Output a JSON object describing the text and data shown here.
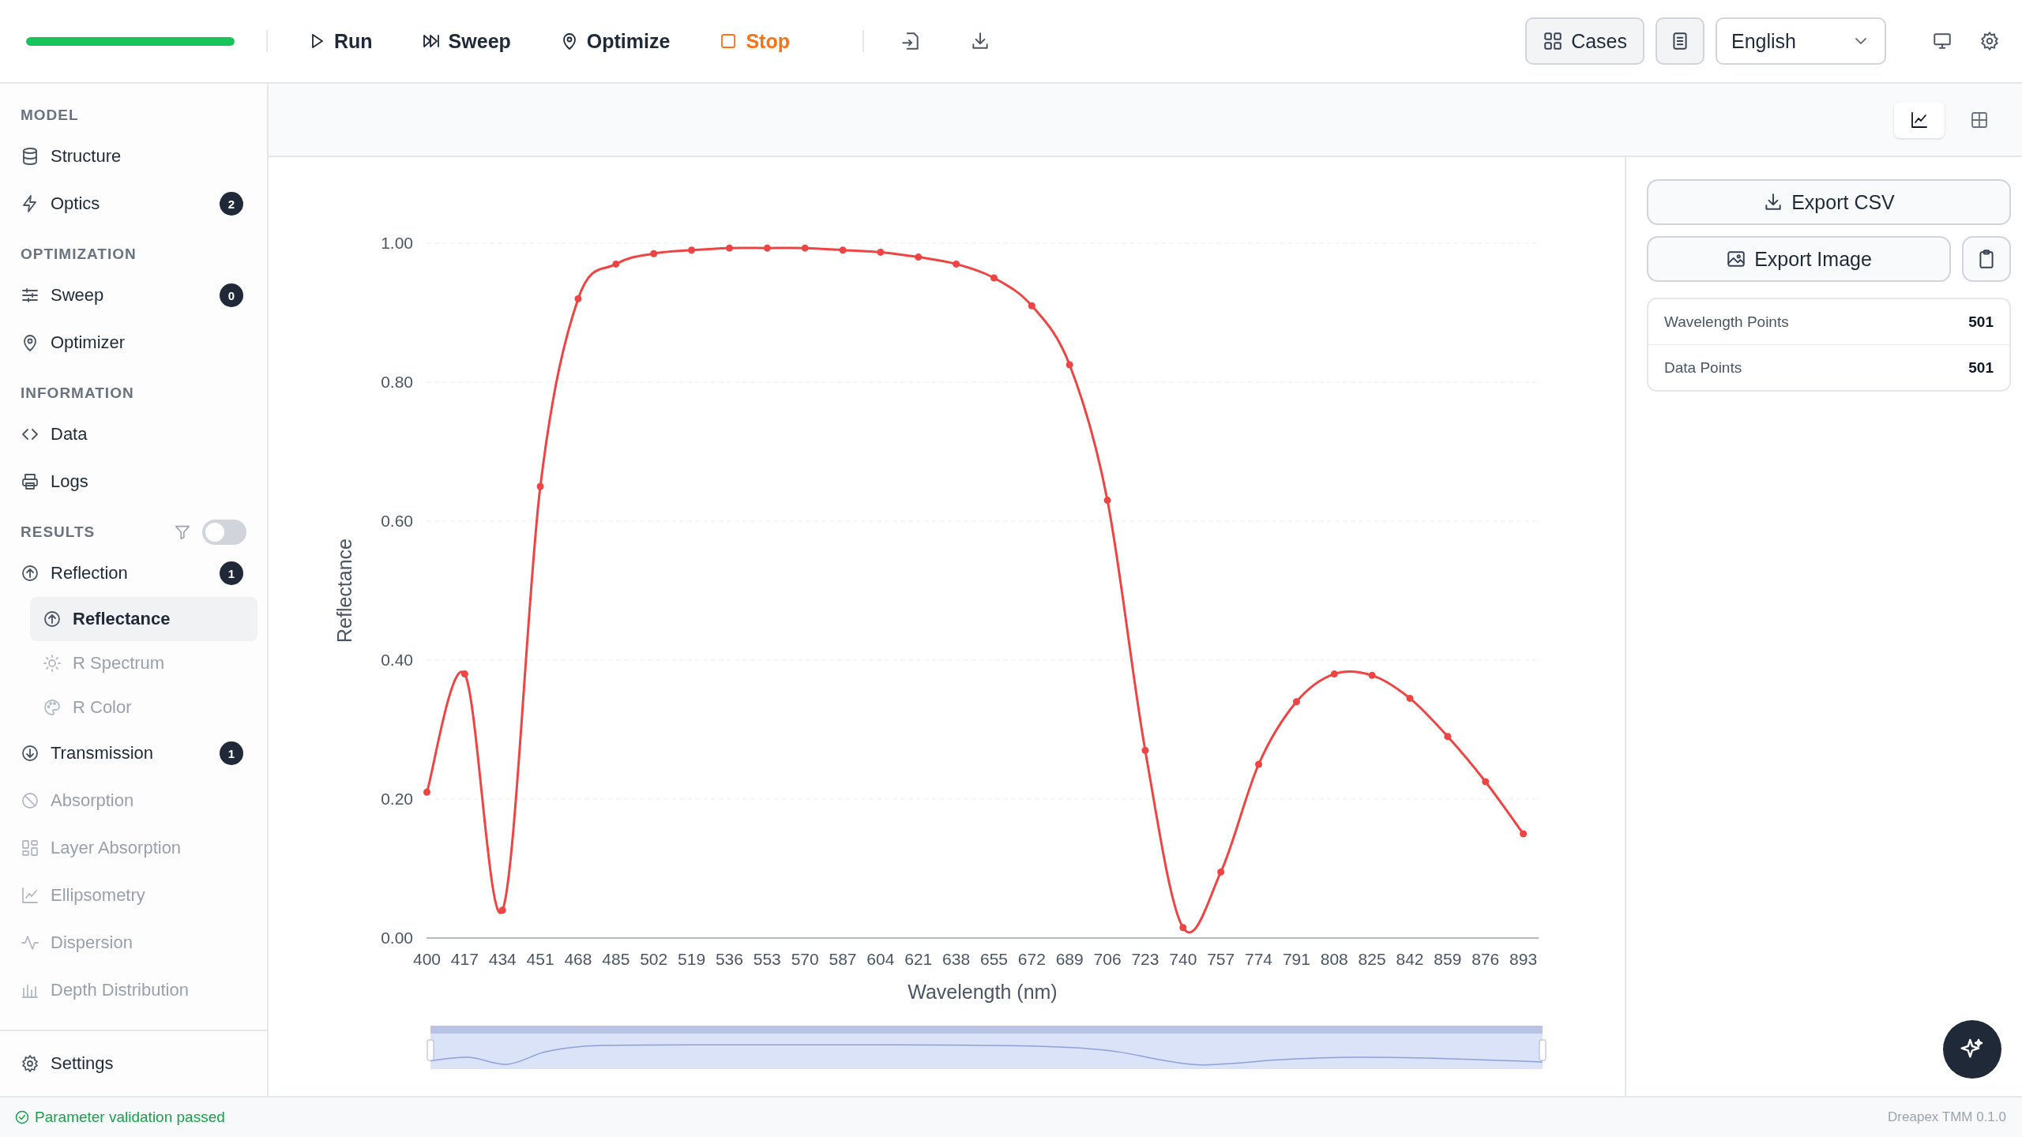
{
  "toolbar": {
    "progress": {
      "level": 1.0
    },
    "actions": [
      {
        "label": "Run",
        "kind": "run"
      },
      {
        "label": "Sweep",
        "kind": "sweep"
      },
      {
        "label": "Optimize",
        "kind": "optimize"
      },
      {
        "label": "Stop",
        "kind": "stop"
      }
    ],
    "cases_button": "Cases",
    "language": "English"
  },
  "sidebar": {
    "sections": [
      {
        "title": "MODEL",
        "items": [
          {
            "label": "Structure",
            "selected": false,
            "disabled": false
          },
          {
            "label": "Optics",
            "badge": "2",
            "selected": false,
            "disabled": false
          }
        ]
      },
      {
        "title": "OPTIMIZATION",
        "items": [
          {
            "label": "Sweep",
            "badge": "0",
            "selected": false,
            "disabled": false
          },
          {
            "label": "Optimizer",
            "selected": false,
            "disabled": false
          }
        ]
      },
      {
        "title": "INFORMATION",
        "items": [
          {
            "label": "Data",
            "selected": false,
            "disabled": false
          },
          {
            "label": "Logs",
            "selected": false,
            "disabled": false
          }
        ]
      },
      {
        "title": "RESULTS",
        "filter_toggle": {
          "on": false
        },
        "items": [
          {
            "label": "Reflection",
            "badge": "1",
            "selected": false,
            "disabled": false,
            "children": [
              {
                "label": "Reflectance",
                "selected": true,
                "disabled": false
              },
              {
                "label": "R Spectrum",
                "selected": false,
                "disabled": true
              },
              {
                "label": "R Color",
                "selected": false,
                "disabled": true
              }
            ]
          },
          {
            "label": "Transmission",
            "badge": "1",
            "selected": false,
            "disabled": false
          },
          {
            "label": "Absorption",
            "selected": false,
            "disabled": true
          },
          {
            "label": "Layer Absorption",
            "selected": false,
            "disabled": true
          },
          {
            "label": "Ellipsometry",
            "selected": false,
            "disabled": true
          },
          {
            "label": "Dispersion",
            "selected": false,
            "disabled": true
          },
          {
            "label": "Depth Distribution",
            "selected": false,
            "disabled": true
          }
        ]
      }
    ],
    "settings": "Settings"
  },
  "view_toggle": [
    {
      "selected": true
    },
    {
      "selected": false
    }
  ],
  "chart": {
    "chart_data": {
      "type": "line",
      "xlabel": "Wavelength (nm)",
      "ylabel": "Reflectance",
      "categories": [
        "400",
        "417",
        "434",
        "451",
        "468",
        "485",
        "502",
        "519",
        "536",
        "553",
        "570",
        "587",
        "604",
        "621",
        "638",
        "655",
        "672",
        "689",
        "706",
        "723",
        "740",
        "757",
        "774",
        "791",
        "808",
        "825",
        "842",
        "859",
        "876",
        "893"
      ],
      "grid": true,
      "series": [
        {
          "color": "#ef4444",
          "marker": true,
          "values": [
            0.21,
            0.38,
            0.04,
            0.65,
            0.92,
            0.97,
            0.985,
            0.99,
            0.993,
            0.993,
            0.993,
            0.99,
            0.987,
            0.98,
            0.97,
            0.95,
            0.91,
            0.825,
            0.63,
            0.27,
            0.015,
            0.095,
            0.25,
            0.34,
            0.38,
            0.378,
            0.345,
            0.29,
            0.225,
            0.15
          ]
        }
      ],
      "ylim": [
        0,
        1
      ],
      "yticks": [
        {
          "value": 0,
          "label": "0.00"
        },
        {
          "value": 0.2,
          "label": "0.20"
        },
        {
          "value": 0.4,
          "label": "0.40"
        },
        {
          "value": 0.6,
          "label": "0.60"
        },
        {
          "value": 0.8,
          "label": "0.80"
        },
        {
          "value": 1,
          "label": "1.00"
        }
      ]
    }
  },
  "panel": {
    "export_csv": "Export CSV",
    "export_image": "Export Image",
    "stats": [
      {
        "label": "Wavelength Points",
        "value": "501"
      },
      {
        "label": "Data Points",
        "value": "501"
      }
    ]
  },
  "status_bar": {
    "message": "Parameter validation passed",
    "kind": "ok",
    "version": "Dreapex TMM 0.1.0"
  }
}
